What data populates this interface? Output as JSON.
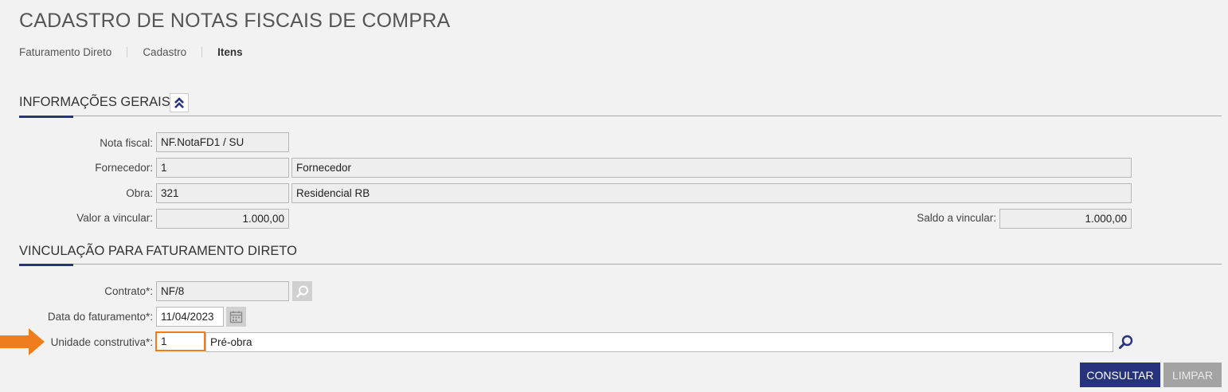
{
  "page": {
    "title": "CADASTRO DE NOTAS FISCAIS DE COMPRA"
  },
  "breadcrumb": [
    "Faturamento Direto",
    "Cadastro",
    "Itens"
  ],
  "general": {
    "title": "INFORMAÇÕES GERAIS",
    "nota_fiscal": {
      "label": "Nota fiscal:",
      "value": "NF.NotaFD1 / SU"
    },
    "fornecedor": {
      "label": "Fornecedor:",
      "code": "1",
      "name": "Fornecedor"
    },
    "obra": {
      "label": "Obra:",
      "code": "321",
      "name": "Residencial RB"
    },
    "valor": {
      "label": "Valor a vincular:",
      "value": "1.000,00"
    },
    "saldo": {
      "label": "Saldo a vincular:",
      "value": "1.000,00"
    }
  },
  "vinculacao": {
    "title": "VINCULAÇÃO PARA FATURAMENTO DIRETO",
    "contrato": {
      "label": "Contrato*:",
      "value": "NF/8"
    },
    "data": {
      "label": "Data do faturamento*:",
      "value": "11/04/2023"
    },
    "unidade": {
      "label": "Unidade construtiva*:",
      "code": "1",
      "name": "Pré-obra"
    }
  },
  "actions": {
    "consultar": "CONSULTAR",
    "limpar": "LIMPAR"
  },
  "icons": {
    "collapse": "double-chevron-up-icon",
    "contrato_search": "search-icon",
    "calendar": "calendar-icon",
    "unidade_search": "search-icon",
    "pointer": "arrow-right-icon"
  },
  "colors": {
    "accent": "#27347b",
    "highlight": "#f07d1c",
    "disabled": "#a3a3a3"
  }
}
